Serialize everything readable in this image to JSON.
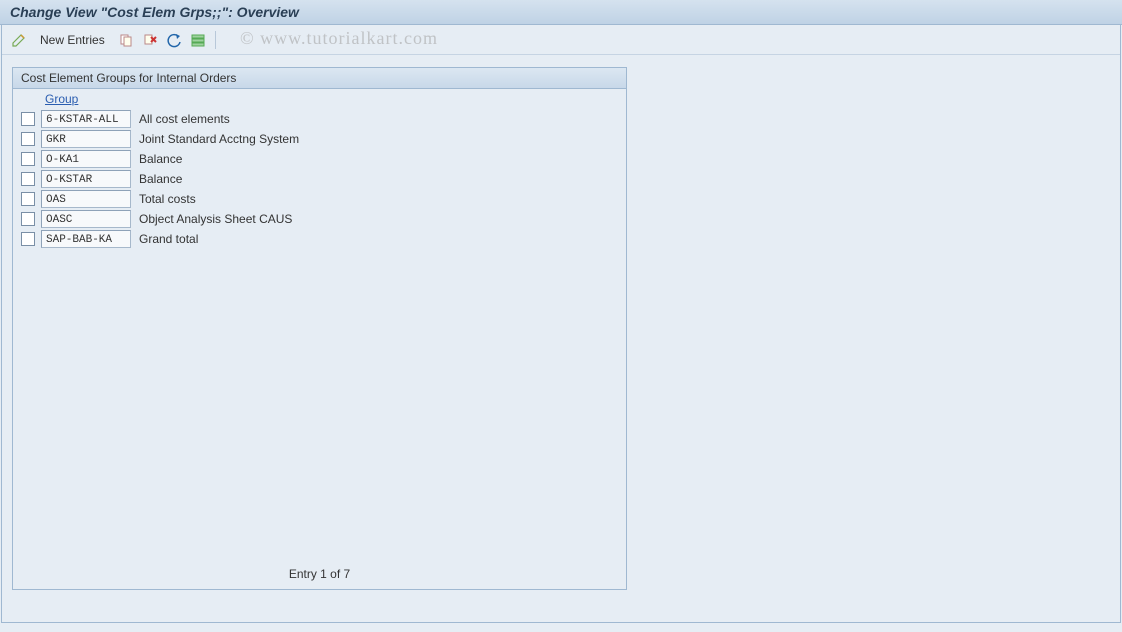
{
  "title": "Change View \"Cost Elem Grps;;\": Overview",
  "watermark": "© www.tutorialkart.com",
  "toolbar": {
    "new_entries": "New Entries"
  },
  "panel": {
    "header": "Cost Element Groups for Internal Orders",
    "column_label": "Group",
    "entry_status": "Entry 1 of 7",
    "rows": [
      {
        "code": "6-KSTAR-ALL",
        "desc": "All cost elements"
      },
      {
        "code": "GKR",
        "desc": "Joint Standard Acctng System"
      },
      {
        "code": "O-KA1",
        "desc": "Balance"
      },
      {
        "code": "O-KSTAR",
        "desc": "Balance"
      },
      {
        "code": "OAS",
        "desc": "Total costs"
      },
      {
        "code": "OASC",
        "desc": "Object Analysis Sheet CAUS"
      },
      {
        "code": "SAP-BAB-KA",
        "desc": "Grand total"
      }
    ]
  }
}
